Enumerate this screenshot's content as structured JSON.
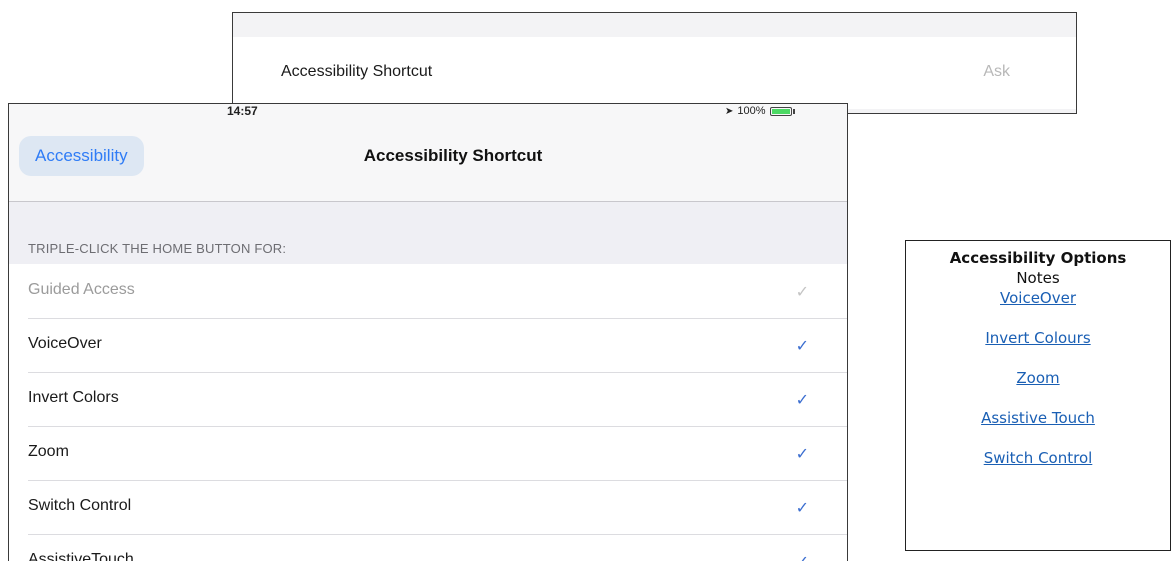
{
  "inset": {
    "label": "Accessibility Shortcut",
    "value": "Ask"
  },
  "status_bar": {
    "time": "14:57",
    "battery": "100%",
    "battery_level": 1.0,
    "battery_color": "#4cd964"
  },
  "nav": {
    "back_label": "Accessibility",
    "title": "Accessibility Shortcut"
  },
  "section_header": "TRIPLE-CLICK THE HOME BUTTON FOR:",
  "options": [
    {
      "label": "Guided Access",
      "checked": true,
      "disabled": true
    },
    {
      "label": "VoiceOver",
      "checked": true,
      "disabled": false
    },
    {
      "label": "Invert Colors",
      "checked": true,
      "disabled": false
    },
    {
      "label": "Zoom",
      "checked": true,
      "disabled": false
    },
    {
      "label": "Switch Control",
      "checked": true,
      "disabled": false
    },
    {
      "label": "AssistiveTouch",
      "checked": true,
      "disabled": false
    }
  ],
  "notes": {
    "title": "Accessibility Options",
    "subtitle": "Notes",
    "links": [
      "VoiceOver",
      "Invert Colours",
      "Zoom",
      "Assistive Touch",
      "Switch Control"
    ]
  },
  "colors": {
    "accent": "#2f7cf6",
    "check": "#3b6ed0",
    "link": "#1a5fb4"
  }
}
